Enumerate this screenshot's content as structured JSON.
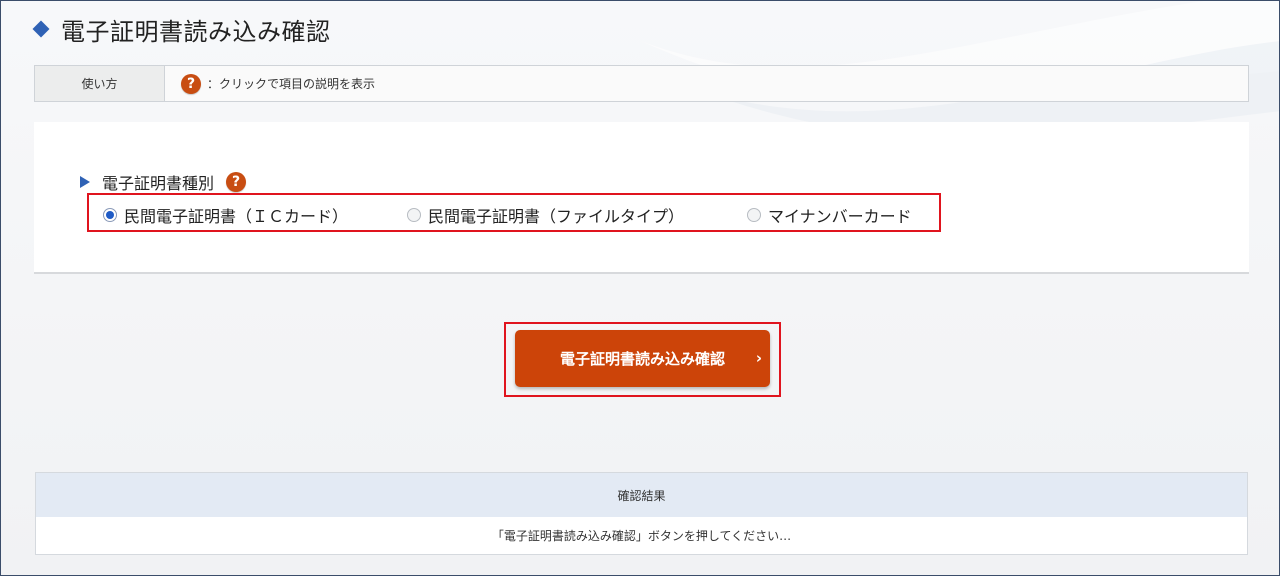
{
  "page": {
    "title": "電子証明書読み込み確認"
  },
  "usage": {
    "label": "使い方",
    "help_icon": "question-icon",
    "description": "：クリックで項目の説明を表示"
  },
  "cert_type": {
    "label": "電子証明書種別",
    "help_icon": "question-icon",
    "options": [
      {
        "label": "民間電子証明書（ＩＣカード）",
        "checked": true
      },
      {
        "label": "民間電子証明書（ファイルタイプ）",
        "checked": false
      },
      {
        "label": "マイナンバーカード",
        "checked": false
      }
    ]
  },
  "confirm_button": {
    "label": "電子証明書読み込み確認",
    "chevron": "›"
  },
  "result": {
    "header": "確認結果",
    "message": "「電子証明書読み込み確認」ボタンを押してください…"
  },
  "colors": {
    "accent_blue": "#2f62b5",
    "button_orange": "#cc4409",
    "highlight_red": "#e0141e",
    "help_icon_orange": "#c84d12"
  }
}
